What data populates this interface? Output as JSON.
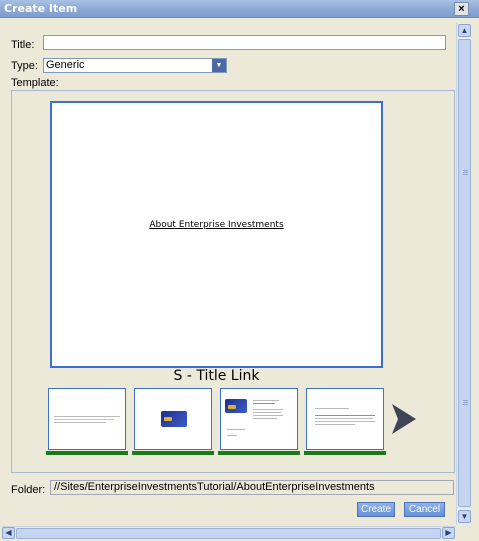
{
  "window": {
    "title": "Create Item",
    "close_glyph": "×"
  },
  "form": {
    "title_label": "Title:",
    "title_value": "",
    "type_label": "Type:",
    "type_value": "Generic",
    "template_label": "Template:",
    "folder_label": "Folder:",
    "folder_value": "//Sites/EnterpriseInvestmentsTutorial/AboutEnterpriseInvestments"
  },
  "template": {
    "preview_link": "About Enterprise Investments",
    "selected_name": "S - Title Link",
    "thumbnails": [
      "text-layout",
      "credit-card",
      "card-with-text",
      "text-page"
    ]
  },
  "buttons": {
    "create": "Create",
    "cancel": "Cancel"
  },
  "icons": {
    "close": "close-icon",
    "next": "chevron-right-icon",
    "scroll_up": "arrow-up-icon",
    "scroll_down": "arrow-down-icon",
    "scroll_left": "arrow-left-icon",
    "scroll_right": "arrow-right-icon"
  },
  "colors": {
    "accent": "#3d6fd0",
    "selection_bar": "#1b7a1b",
    "titlebar": "#8eaad6"
  }
}
